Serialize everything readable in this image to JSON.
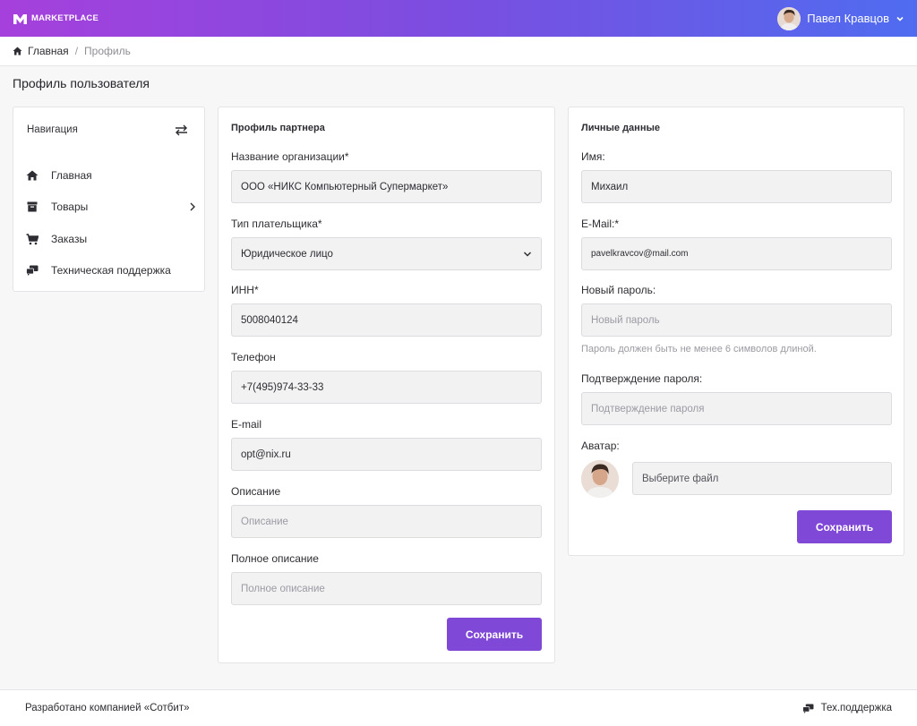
{
  "header": {
    "logo_text": "MARKETPLACE",
    "user_name": "Павел Кравцов",
    "gradient": [
      "#a640dc",
      "#4f6cf0"
    ]
  },
  "breadcrumb": {
    "home": "Главная",
    "separator": "/",
    "current": "Профиль"
  },
  "page_title": "Профиль пользователя",
  "navigation": {
    "title": "Навигация",
    "items": [
      {
        "label": "Главная",
        "icon": "home-icon"
      },
      {
        "label": "Товары",
        "icon": "box-icon",
        "has_submenu": true
      },
      {
        "label": "Заказы",
        "icon": "cart-icon"
      },
      {
        "label": "Техническая поддержка",
        "icon": "chat-icon"
      }
    ]
  },
  "partner_profile": {
    "title": "Профиль партнера",
    "org_name_label": "Название организации*",
    "org_name_value": "ООО «НИКС Компьютерный Супермаркет»",
    "payer_type_label": "Тип плательщика*",
    "payer_type_value": "Юридическое лицо",
    "inn_label": "ИНН*",
    "inn_value": "5008040124",
    "phone_label": "Телефон",
    "phone_value": "+7(495)974-33-33",
    "email_label": "E-mail",
    "email_value": "opt@nix.ru",
    "description_label": "Описание",
    "description_placeholder": "Описание",
    "full_description_label": "Полное описание",
    "full_description_placeholder": "Полное описание",
    "save_label": "Сохранить"
  },
  "personal_data": {
    "title": "Личные данные",
    "name_label": "Имя:",
    "name_value": "Михаил",
    "email_label": "E-Mail:*",
    "email_value": "pavelkravcov@mail.com",
    "new_password_label": "Новый пароль:",
    "new_password_placeholder": "Новый пароль",
    "password_hint": "Пароль должен быть не менее 6 символов длиной.",
    "confirm_password_label": "Подтверждение пароля:",
    "confirm_password_placeholder": "Подтверждение пароля",
    "avatar_label": "Аватар:",
    "file_placeholder": "Выберите файл",
    "save_label": "Сохранить"
  },
  "footer": {
    "developer": "Разработано компанией «Сотбит»",
    "support": "Тех.поддержка"
  },
  "colors": {
    "accent": "#8048d6",
    "field_bg": "#f2f2f3"
  }
}
